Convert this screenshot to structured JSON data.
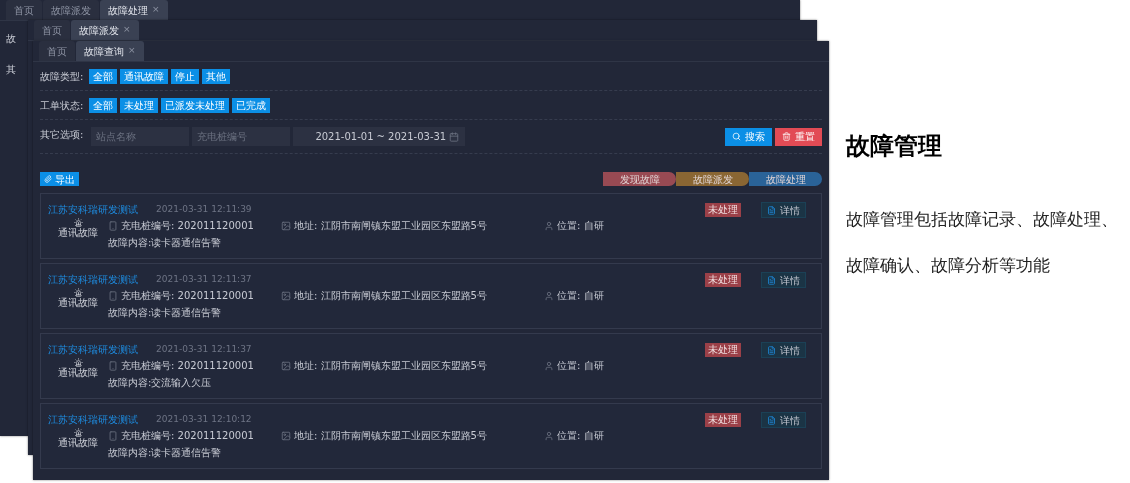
{
  "back_windows": [
    {
      "tabs": [
        {
          "label": "首页",
          "selected": false
        },
        {
          "label": "故障派发",
          "selected": false
        },
        {
          "label": "故障处理",
          "selected": true,
          "close": "×"
        }
      ],
      "side_labels": [
        "故",
        "其"
      ]
    },
    {
      "tabs": [
        {
          "label": "首页",
          "selected": false
        },
        {
          "label": "故障派发",
          "selected": true,
          "close": "×"
        }
      ]
    }
  ],
  "window": {
    "tabs": [
      {
        "label": "首页",
        "selected": false
      },
      {
        "label": "故障查询",
        "selected": true,
        "close": "×"
      }
    ],
    "filters": [
      {
        "label": "故障类型:",
        "options": [
          "全部",
          "通讯故障",
          "停止",
          "其他"
        ]
      },
      {
        "label": "工单状态:",
        "options": [
          "全部",
          "未处理",
          "已派发未处理",
          "已完成"
        ]
      }
    ],
    "other_options": {
      "label": "其它选项:",
      "station_placeholder": "站点名称",
      "pile_placeholder": "充电桩编号",
      "date_start": "2021-01-01",
      "date_separator": "~",
      "date_end": "2021-03-31"
    },
    "search_button": "搜索",
    "reset_button": "重置",
    "export_button": "导出",
    "steps": [
      {
        "label": "发现故障",
        "color": "#984a53"
      },
      {
        "label": "故障派发",
        "color": "#8a6633"
      },
      {
        "label": "故障处理",
        "color": "#2a6398"
      }
    ],
    "records": [
      {
        "name": "江苏安科瑞研发测试",
        "time": "2021-03-31 12:11:39",
        "type": "通讯故障",
        "pile": "充电桩编号: 202011120001",
        "address": "地址: 江阴市南闸镇东盟工业园区东盟路5号",
        "location": "位置: 自研",
        "content": "故障内容:读卡器通信告警",
        "status": "未处理",
        "detail": "详情"
      },
      {
        "name": "江苏安科瑞研发测试",
        "time": "2021-03-31 12:11:37",
        "type": "通讯故障",
        "pile": "充电桩编号: 202011120001",
        "address": "地址: 江阴市南闸镇东盟工业园区东盟路5号",
        "location": "位置: 自研",
        "content": "故障内容:读卡器通信告警",
        "status": "未处理",
        "detail": "详情"
      },
      {
        "name": "江苏安科瑞研发测试",
        "time": "2021-03-31 12:11:37",
        "type": "通讯故障",
        "pile": "充电桩编号: 202011120001",
        "address": "地址: 江阴市南闸镇东盟工业园区东盟路5号",
        "location": "位置: 自研",
        "content": "故障内容:交流输入欠压",
        "status": "未处理",
        "detail": "详情"
      },
      {
        "name": "江苏安科瑞研发测试",
        "time": "2021-03-31 12:10:12",
        "type": "通讯故障",
        "pile": "充电桩编号: 202011120001",
        "address": "地址: 江阴市南闸镇东盟工业园区东盟路5号",
        "location": "位置: 自研",
        "content": "故障内容:读卡器通信告警",
        "status": "未处理",
        "detail": "详情"
      }
    ]
  },
  "intro": {
    "title": "故障管理",
    "text": "故障管理包括故障记录、故障处理、故障确认、故障分析等功能"
  }
}
